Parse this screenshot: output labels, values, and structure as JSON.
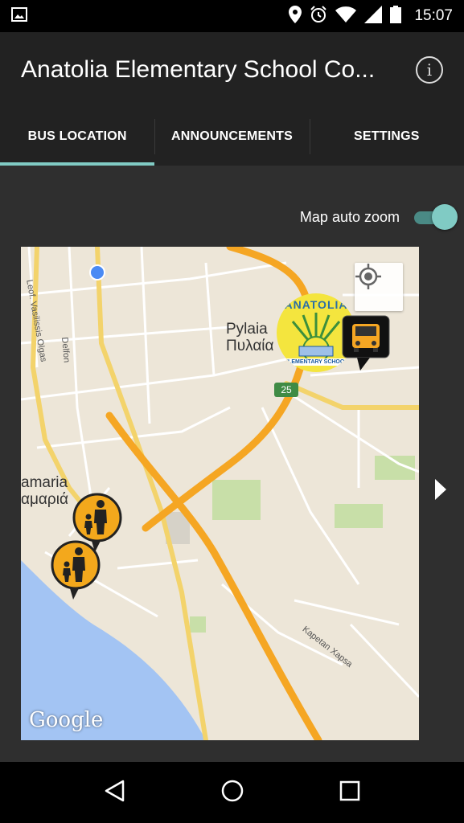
{
  "status_bar": {
    "time": "15:07",
    "icons": [
      "image-icon",
      "location-icon",
      "alarm-icon",
      "wifi-icon",
      "signal-icon",
      "battery-icon"
    ]
  },
  "action_bar": {
    "title": "Anatolia Elementary School Co...",
    "info_icon": "info-icon"
  },
  "tabs": [
    {
      "label": "BUS LOCATION",
      "active": true
    },
    {
      "label": "ANNOUNCEMENTS",
      "active": false
    },
    {
      "label": "SETTINGS",
      "active": false
    }
  ],
  "map_auto_zoom": {
    "label": "Map auto zoom",
    "enabled": true
  },
  "map": {
    "places": {
      "pylaia_latin": "Pylaia",
      "pylaia_greek": "Πυλαία",
      "kalamaria_latin": "amaria",
      "kalamaria_greek": "αμαριά"
    },
    "roads": {
      "vasilissis": "Leof. Vasilissis Olgas",
      "delfon": "Delfon",
      "kapetan": "Kapetan Xapsa"
    },
    "route_shield": "25",
    "school_logo_top": "ANATOLIA",
    "school_logo_bottom": "ELEMENTARY SCHOOL",
    "attribution": "Google"
  },
  "colors": {
    "accent": "#80cbc4",
    "app_bar": "#222222",
    "content_bg": "#2f2f2f",
    "highway": "#f5a623",
    "major_road": "#f3d36b",
    "water": "#a3c4f3",
    "park": "#c8dfa8"
  },
  "nav_bar": {
    "icons": [
      "back-icon",
      "home-icon",
      "recents-icon"
    ]
  }
}
